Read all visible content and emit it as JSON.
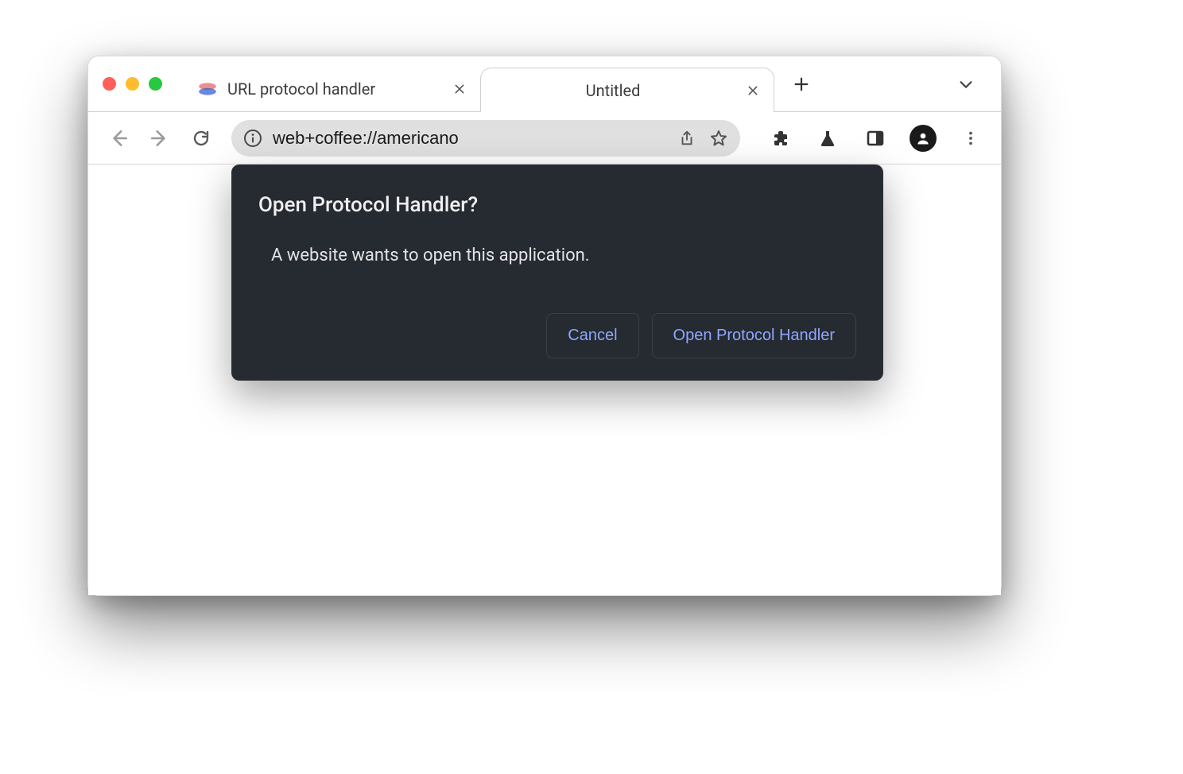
{
  "tabs": [
    {
      "title": "URL protocol handler",
      "active": false
    },
    {
      "title": "Untitled",
      "active": true
    }
  ],
  "addressbar": {
    "value": "web+coffee://americano"
  },
  "dialog": {
    "title": "Open Protocol Handler?",
    "message": "A website wants to open this application.",
    "cancel_label": "Cancel",
    "confirm_label": "Open Protocol Handler"
  }
}
